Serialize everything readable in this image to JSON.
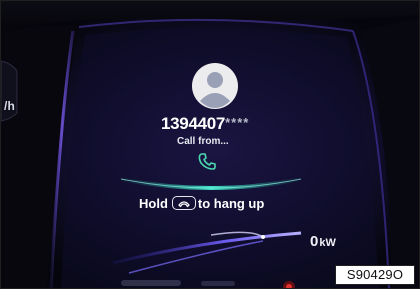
{
  "cluster": {
    "speed_unit": "/h",
    "incoming_call": {
      "number": "1394407",
      "masked_suffix": "****",
      "status": "Call from...",
      "icon": "phone-icon"
    },
    "hint": {
      "prefix": "Hold",
      "key_icon": "hang-up-icon",
      "suffix": "to hang up"
    },
    "power": {
      "value": "0",
      "unit": "kW"
    }
  },
  "figure_code": "S90429O",
  "colors": {
    "background": "#06070f",
    "accent_purple": "#5a3fc8",
    "accent_teal": "#3ee2c8",
    "phone_icon": "#49d9b0",
    "text": "#ffffff"
  }
}
